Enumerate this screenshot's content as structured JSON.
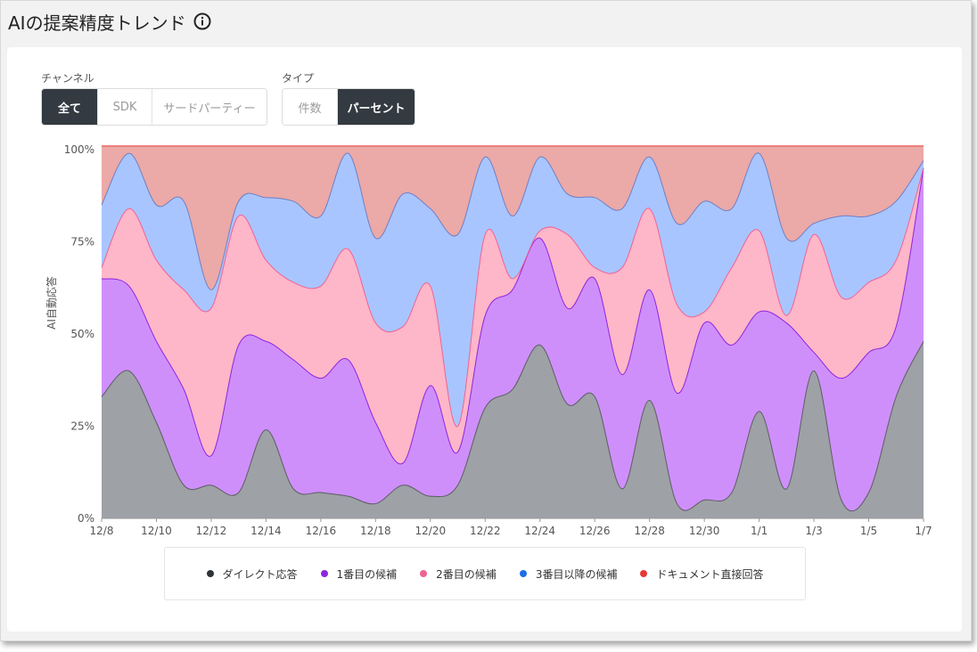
{
  "title": "AIの提案精度トレンド",
  "filters": {
    "channel": {
      "label": "チャンネル",
      "options": [
        "全て",
        "SDK",
        "サードパーティー"
      ],
      "selected": 0
    },
    "type": {
      "label": "タイプ",
      "options": [
        "件数",
        "パーセント"
      ],
      "selected": 1
    }
  },
  "legend": [
    {
      "label": "ダイレクト応答",
      "color": "#2f3337"
    },
    {
      "label": "1番目の候補",
      "color": "#8e24e0"
    },
    {
      "label": "2番目の候補",
      "color": "#f06292"
    },
    {
      "label": "3番目以降の候補",
      "color": "#1e6fe8"
    },
    {
      "label": "ドキュメント直接回答",
      "color": "#e53935"
    }
  ],
  "chart_data": {
    "type": "area",
    "stacked": true,
    "ylabel": "AI自動応答",
    "yticks": [
      "0%",
      "25%",
      "50%",
      "75%",
      "100%"
    ],
    "ylim": [
      0,
      100
    ],
    "xtick_labels": [
      "12/8",
      "12/10",
      "12/12",
      "12/14",
      "12/16",
      "12/18",
      "12/20",
      "12/22",
      "12/24",
      "12/26",
      "12/28",
      "12/30",
      "1/1",
      "1/3",
      "1/5",
      "1/7"
    ],
    "x": [
      "12/8",
      "12/9",
      "12/10",
      "12/11",
      "12/12",
      "12/13",
      "12/14",
      "12/15",
      "12/16",
      "12/17",
      "12/18",
      "12/19",
      "12/20",
      "12/21",
      "12/22",
      "12/23",
      "12/24",
      "12/25",
      "12/26",
      "12/27",
      "12/28",
      "12/29",
      "12/30",
      "12/31",
      "1/1",
      "1/2",
      "1/3",
      "1/4",
      "1/5",
      "1/6",
      "1/7"
    ],
    "grid": true,
    "series": [
      {
        "name": "ダイレクト応答",
        "color": "#9ea1a6",
        "line": "#5a5e63",
        "values": [
          33,
          40,
          26,
          9,
          9,
          7,
          24,
          8,
          7,
          6,
          4,
          9,
          6,
          9,
          30,
          35,
          47,
          31,
          33,
          8,
          32,
          4,
          5,
          7,
          29,
          8,
          40,
          5,
          7,
          33,
          48
        ]
      },
      {
        "name": "1番目の候補",
        "color": "#cf8ffb",
        "line": "#8e24e0",
        "cumulative": [
          65,
          63,
          48,
          35,
          17,
          47,
          48,
          43,
          38,
          43,
          26,
          15,
          36,
          18,
          55,
          62,
          76,
          57,
          65,
          39,
          62,
          34,
          53,
          47,
          56,
          53,
          45,
          38,
          45,
          52,
          95
        ]
      },
      {
        "name": "2番目の候補",
        "color": "#feb6c9",
        "line": "#f06292",
        "cumulative": [
          68,
          84,
          70,
          62,
          57,
          82,
          70,
          64,
          63,
          73,
          53,
          52,
          63,
          25,
          77,
          65,
          78,
          77,
          68,
          68,
          84,
          58,
          56,
          68,
          78,
          55,
          77,
          60,
          64,
          70,
          95
        ]
      },
      {
        "name": "3番目以降の候補",
        "color": "#a9c5ff",
        "line": "#6f7fc4",
        "cumulative": [
          85,
          99,
          85,
          86,
          62,
          86,
          87,
          86,
          82,
          99,
          76,
          88,
          84,
          77,
          98,
          82,
          98,
          88,
          87,
          84,
          98,
          80,
          86,
          84,
          99,
          76,
          80,
          82,
          82,
          86,
          97
        ]
      },
      {
        "name": "ドキュメント直接回答",
        "color": "#eba9a7",
        "line": "#e53935",
        "cumulative": [
          101,
          101,
          101,
          101,
          101,
          101,
          101,
          101,
          101,
          101,
          101,
          101,
          101,
          101,
          101,
          101,
          101,
          101,
          101,
          101,
          101,
          101,
          101,
          101,
          101,
          101,
          101,
          101,
          101,
          101,
          101
        ]
      }
    ]
  }
}
